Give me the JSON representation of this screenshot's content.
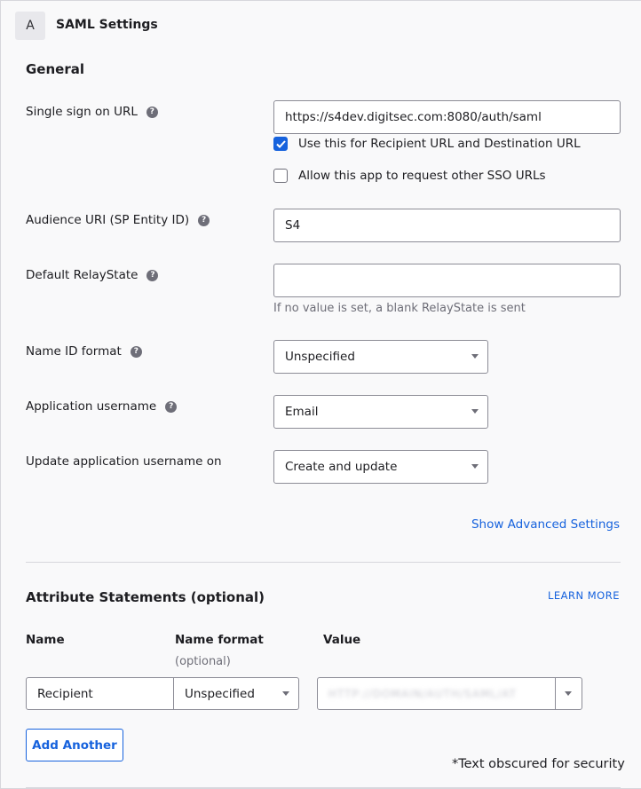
{
  "header": {
    "step": "A",
    "title": "SAML Settings"
  },
  "general": {
    "title": "General",
    "sso_url": {
      "label": "Single sign on URL",
      "value": "https://s4dev.digitsec.com:8080/auth/saml",
      "recipient_checkbox": {
        "label": "Use this for Recipient URL and Destination URL",
        "checked": true
      },
      "other_sso_checkbox": {
        "label": "Allow this app to request other SSO URLs",
        "checked": false
      }
    },
    "audience": {
      "label": "Audience URI (SP Entity ID)",
      "value": "S4"
    },
    "relay_state": {
      "label": "Default RelayState",
      "value": "",
      "hint": "If no value is set, a blank RelayState is sent"
    },
    "name_id_format": {
      "label": "Name ID format",
      "value": "Unspecified"
    },
    "app_username": {
      "label": "Application username",
      "value": "Email"
    },
    "update_username": {
      "label": "Update application username on",
      "value": "Create and update"
    },
    "advanced_link": "Show Advanced Settings"
  },
  "attributes": {
    "title": "Attribute Statements (optional)",
    "learn_more": "LEARN MORE",
    "columns": {
      "name": "Name",
      "name_format": "Name format",
      "name_format_sub": "(optional)",
      "value": "Value"
    },
    "row": {
      "name": "Recipient",
      "format": "Unspecified",
      "value": "HTTP://DOMAIN/AUTH/SAML/AT"
    },
    "add_button": "Add Another",
    "note": "*Text obscured for security"
  },
  "colors": {
    "accent": "#1662dd",
    "border": "#8c8c96",
    "muted": "#6e6e78"
  }
}
